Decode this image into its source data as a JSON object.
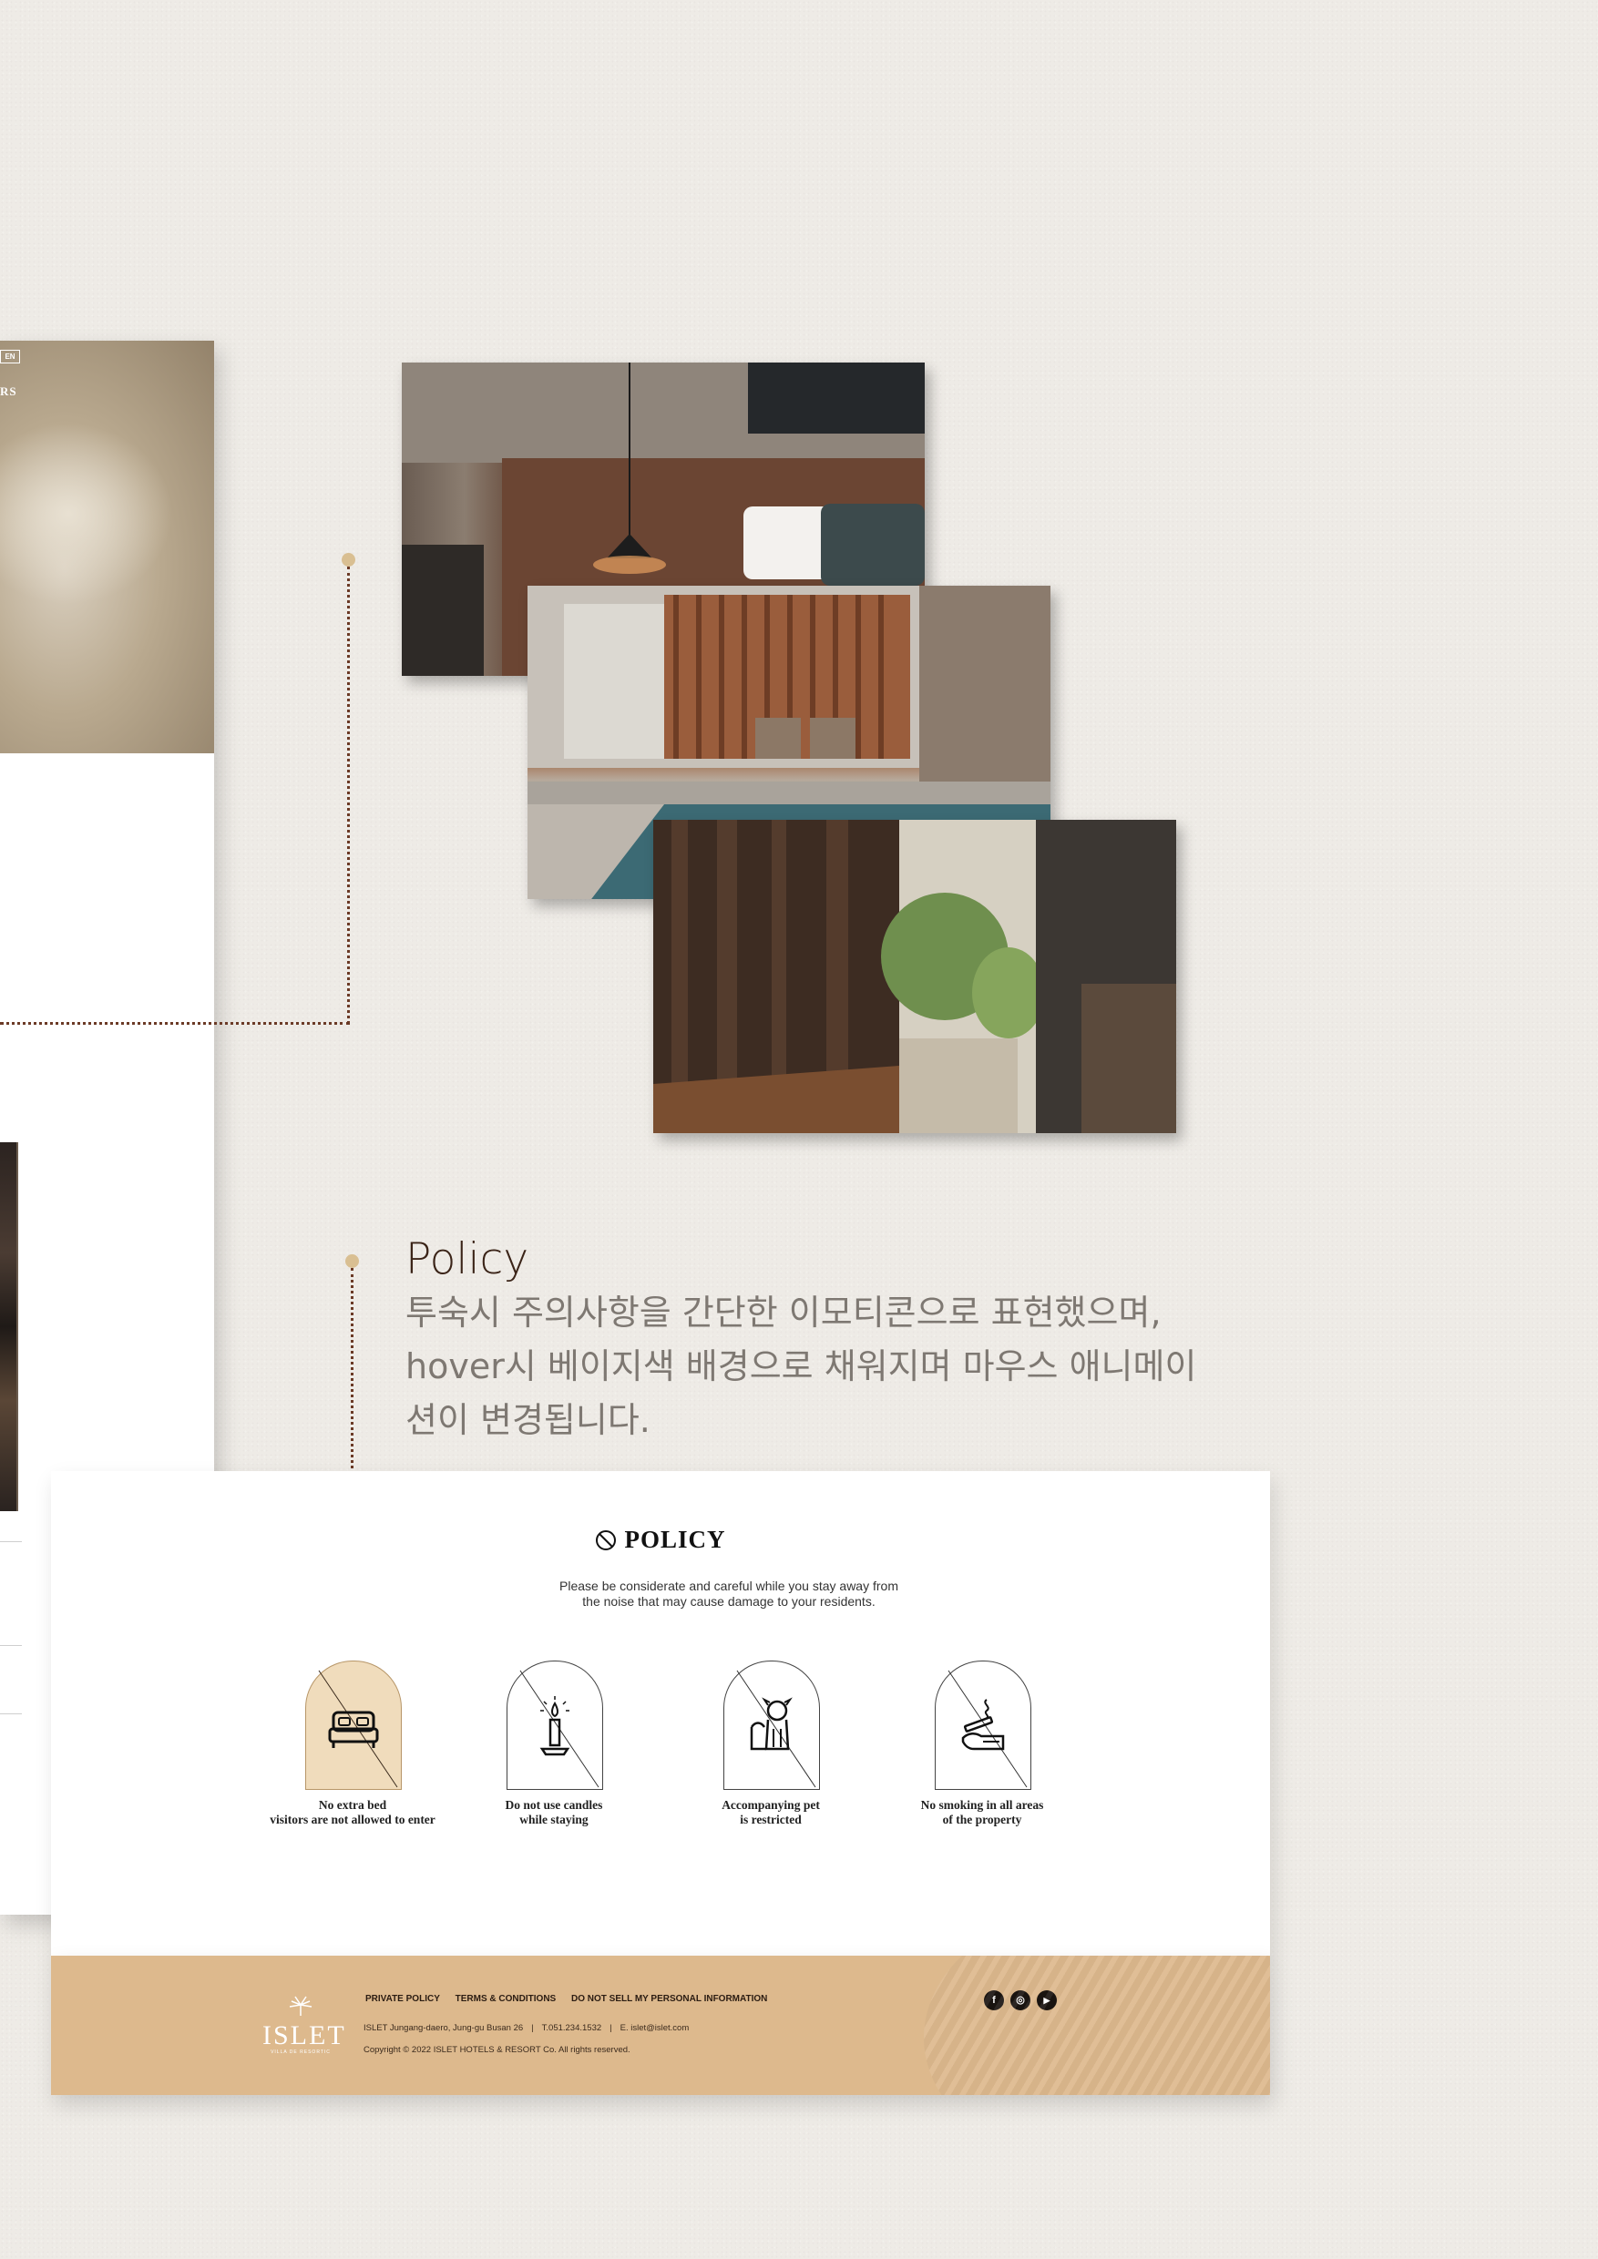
{
  "left_page": {
    "lang_badge": "EN",
    "hero_text": "RS"
  },
  "policy_intro": {
    "heading": "Policy",
    "description": "투숙시 주의사항을 간단한 이모티콘으로 표현했으며, hover시 베이지색 배경으로 채워지며 마우스 애니메이션이 변경됩니다."
  },
  "policy_section": {
    "title": "POLICY",
    "subtitle_line1": "Please be considerate and careful while you stay away from",
    "subtitle_line2": "the noise that may cause damage to your residents.",
    "items": [
      {
        "icon": "no-extra-bed-icon",
        "line1": "No extra bed",
        "line2": "visitors are not allowed to enter",
        "state": "hover"
      },
      {
        "icon": "no-candles-icon",
        "line1": "Do not use candles",
        "line2": "while staying",
        "state": "default"
      },
      {
        "icon": "no-pets-icon",
        "line1": "Accompanying pet",
        "line2": "is restricted",
        "state": "default"
      },
      {
        "icon": "no-smoking-icon",
        "line1": "No smoking in all areas",
        "line2": "of the property",
        "state": "default"
      }
    ],
    "hover_color": "#f0dcbc"
  },
  "footer": {
    "logo_word": "ISLET",
    "logo_tag": "VILLA DE RESORTIC",
    "links": [
      "PRIVATE POLICY",
      "TERMS & CONDITIONS",
      "DO NOT SELL MY PERSONAL INFORMATION"
    ],
    "address": "ISLET  Jungang-daero, Jung-gu Busan 26",
    "phone": "T.051.234.1532",
    "email": "E. islet@islet.com",
    "copyright": "Copyright © 2022 ISLET HOTELS & RESORT Co. All rights reserved.",
    "social": [
      {
        "icon": "facebook-icon",
        "glyph": "f"
      },
      {
        "icon": "instagram-icon",
        "glyph": "◎"
      },
      {
        "icon": "youtube-icon",
        "glyph": "▶"
      }
    ],
    "background": "#ddb98d"
  },
  "colors": {
    "accent_dot": "#d9bf92",
    "connector": "#6b3a26",
    "heading": "#3b2418",
    "page_bg": "#eeebe6"
  }
}
